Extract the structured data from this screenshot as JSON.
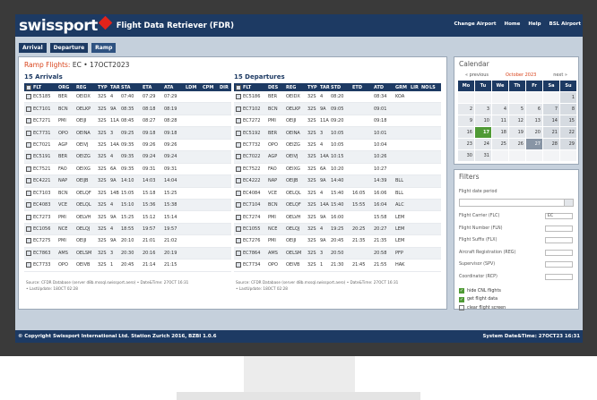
{
  "app": {
    "logo": "swissport",
    "title": "Flight Data Retriever (FDR)"
  },
  "topnav": [
    "Change Airport",
    "Home",
    "Help",
    "BSL Airport"
  ],
  "mode_tabs": [
    "Arrival",
    "Departure",
    "Ramp"
  ],
  "ramp": {
    "label": "Ramp Flights:",
    "value": "EC • 17OCT2023"
  },
  "arrivals": {
    "title": "15 Arrivals",
    "columns": [
      "FLT",
      "ORG",
      "REG",
      "TYP",
      "TAR",
      "STA",
      "ETA",
      "ATA",
      "LDM",
      "CPM",
      "DIR"
    ],
    "rows": [
      [
        "EC5185",
        "BER",
        "OEIDX",
        "32S",
        "4",
        "07:40",
        "07:29",
        "07:29",
        "",
        "",
        ""
      ],
      [
        "EC7101",
        "BCN",
        "OELKP",
        "32S",
        "9A",
        "08:35",
        "08:18",
        "08:19",
        "",
        "",
        ""
      ],
      [
        "EC7271",
        "PMI",
        "OEIJI",
        "32S",
        "11A",
        "08:45",
        "08:27",
        "08:28",
        "",
        "",
        ""
      ],
      [
        "EC7731",
        "OPO",
        "OEINA",
        "32S",
        "3",
        "09:25",
        "09:18",
        "09:18",
        "",
        "",
        ""
      ],
      [
        "EC7021",
        "AGP",
        "OEIVJ",
        "32S",
        "14A",
        "09:35",
        "09:26",
        "09:26",
        "",
        "",
        ""
      ],
      [
        "EC5191",
        "BER",
        "OEIZG",
        "32S",
        "4",
        "09:35",
        "09:24",
        "09:24",
        "",
        "",
        ""
      ],
      [
        "EC7521",
        "FAO",
        "OEIXG",
        "32S",
        "6A",
        "09:35",
        "09:31",
        "09:31",
        "",
        "",
        ""
      ],
      [
        "EC4221",
        "NAP",
        "OEIJB",
        "32S",
        "9A",
        "14:10",
        "14:03",
        "14:04",
        "",
        "",
        ""
      ],
      [
        "EC7103",
        "BCN",
        "OELQF",
        "32S",
        "14B",
        "15:05",
        "15:18",
        "15:25",
        "",
        "",
        ""
      ],
      [
        "EC4083",
        "VCE",
        "OELQL",
        "32S",
        "4",
        "15:10",
        "15:36",
        "15:38",
        "",
        "",
        ""
      ],
      [
        "EC7273",
        "PMI",
        "OELVH",
        "32S",
        "9A",
        "15:25",
        "15:12",
        "15:14",
        "",
        "",
        ""
      ],
      [
        "EC1056",
        "NCE",
        "OELQJ",
        "32S",
        "4",
        "18:55",
        "19:57",
        "19:57",
        "",
        "",
        ""
      ],
      [
        "EC7275",
        "PMI",
        "OEIJI",
        "32S",
        "9A",
        "20:10",
        "21:01",
        "21:02",
        "",
        "",
        ""
      ],
      [
        "EC7863",
        "AMS",
        "OELSM",
        "32S",
        "3",
        "20:30",
        "20:16",
        "20:19",
        "",
        "",
        ""
      ],
      [
        "EC7733",
        "OPO",
        "OEIVB",
        "32S",
        "1",
        "20:45",
        "21:14",
        "21:15",
        "",
        "",
        ""
      ]
    ]
  },
  "departures": {
    "title": "15 Departures",
    "columns": [
      "FLT",
      "DES",
      "REG",
      "TYP",
      "TAR",
      "STD",
      "ETD",
      "ATD",
      "GRM",
      "LIR",
      "NO",
      "LS"
    ],
    "rows": [
      [
        "EC5186",
        "BER",
        "OEIDX",
        "32S",
        "4",
        "08:20",
        "",
        "08:34",
        "KOA",
        "",
        "",
        ""
      ],
      [
        "EC7102",
        "BCN",
        "OELKP",
        "32S",
        "9A",
        "09:05",
        "",
        "09:01",
        "",
        "",
        "",
        ""
      ],
      [
        "EC7272",
        "PMI",
        "OEIJI",
        "32S",
        "11A",
        "09:20",
        "",
        "09:18",
        "",
        "",
        "",
        ""
      ],
      [
        "EC5192",
        "BER",
        "OEINA",
        "32S",
        "3",
        "10:05",
        "",
        "10:01",
        "",
        "",
        "",
        ""
      ],
      [
        "EC7732",
        "OPO",
        "OEIZG",
        "32S",
        "4",
        "10:05",
        "",
        "10:04",
        "",
        "",
        "",
        ""
      ],
      [
        "EC7022",
        "AGP",
        "OEIVJ",
        "32S",
        "14A",
        "10:15",
        "",
        "10:26",
        "",
        "",
        "",
        ""
      ],
      [
        "EC7522",
        "FAO",
        "OEIXG",
        "32S",
        "6A",
        "10:20",
        "",
        "10:27",
        "",
        "",
        "",
        ""
      ],
      [
        "EC4222",
        "NAP",
        "OEIJB",
        "32S",
        "9A",
        "14:40",
        "",
        "14:39",
        "BLL",
        "",
        "",
        ""
      ],
      [
        "EC4084",
        "VCE",
        "OELQL",
        "32S",
        "4",
        "15:40",
        "16:05",
        "16:06",
        "BLL",
        "",
        "",
        ""
      ],
      [
        "EC7104",
        "BCN",
        "OELQF",
        "32S",
        "14A",
        "15:40",
        "15:55",
        "16:04",
        "ALC",
        "",
        "",
        ""
      ],
      [
        "EC7274",
        "PMI",
        "OELVH",
        "32S",
        "9A",
        "16:00",
        "",
        "15:58",
        "LEM",
        "",
        "",
        ""
      ],
      [
        "EC1055",
        "NCE",
        "OELQJ",
        "32S",
        "4",
        "19:25",
        "20:25",
        "20:27",
        "LEM",
        "",
        "",
        ""
      ],
      [
        "EC7276",
        "PMI",
        "OEIJI",
        "32S",
        "9A",
        "20:45",
        "21:35",
        "21:35",
        "LEM",
        "",
        "",
        ""
      ],
      [
        "EC7864",
        "AMS",
        "OELSM",
        "32S",
        "3",
        "20:50",
        "",
        "20:58",
        "PFP",
        "",
        "",
        ""
      ],
      [
        "EC7734",
        "OPO",
        "OEIVB",
        "32S",
        "1",
        "21:30",
        "21:45",
        "21:55",
        "HAK",
        "",
        "",
        ""
      ]
    ]
  },
  "source_left": [
    "Source: CFDR Database (server d8b.mssql.swissport.aero) • Date&Time: 27OCT 16:31",
    "• LastUpdate: 18OCT 02:28"
  ],
  "source_right": [
    "Source: CFDR Database (server d8b.mssql.swissport.aero) • Date&Time: 27OCT 16:31",
    "• LastUpdate: 18OCT 02:28"
  ],
  "calendar": {
    "title": "Calendar",
    "prev": "« previous",
    "month": "October 2023",
    "next": "next »",
    "weekdays": [
      "Mo",
      "Tu",
      "We",
      "Th",
      "Fr",
      "Sa",
      "Su"
    ],
    "days": [
      "",
      "",
      "",
      "",
      "",
      "",
      "1",
      "2",
      "3",
      "4",
      "5",
      "6",
      "7",
      "8",
      "9",
      "10",
      "11",
      "12",
      "13",
      "14",
      "15",
      "16",
      "17",
      "18",
      "19",
      "20",
      "21",
      "22",
      "23",
      "24",
      "25",
      "26",
      "27",
      "28",
      "29",
      "30",
      "31",
      "",
      "",
      "",
      "",
      ""
    ],
    "selected": "17",
    "today": "27"
  },
  "filters": {
    "title": "Filters",
    "period_label": "Flight date period",
    "fields": [
      {
        "label": "Flight Carrier (FLC)",
        "value": "EC"
      },
      {
        "label": "Flight Number (FLN)",
        "value": ""
      },
      {
        "label": "Flight Suffix (FLX)",
        "value": ""
      },
      {
        "label": "Aircraft Registration (REG)",
        "value": ""
      },
      {
        "label": "Supervisor (SPV)",
        "value": ""
      },
      {
        "label": "Coordinator (RCP)",
        "value": ""
      }
    ],
    "checkboxes": [
      {
        "label": "hide CNL flights",
        "checked": true
      },
      {
        "label": "get flight data",
        "checked": true
      },
      {
        "label": "clear flight screen",
        "checked": false
      }
    ]
  },
  "footer": {
    "left": "© Copyright Swissport International Ltd. Station Zurich 2016, BZBI 1.0.6",
    "right": "System Date&Time: 27OCT23 16:31"
  }
}
